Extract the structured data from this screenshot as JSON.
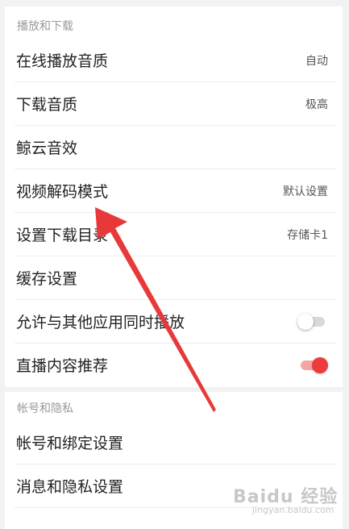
{
  "sections": {
    "playback": {
      "title": "播放和下载",
      "items": [
        {
          "label": "在线播放音质",
          "value": "自动"
        },
        {
          "label": "下载音质",
          "value": "极高"
        },
        {
          "label": "鲸云音效",
          "value": ""
        },
        {
          "label": "视频解码模式",
          "value": "默认设置"
        },
        {
          "label": "设置下载目录",
          "value": "存储卡1"
        },
        {
          "label": "缓存设置",
          "value": ""
        },
        {
          "label": "允许与其他应用同时播放",
          "toggle": false
        },
        {
          "label": "直播内容推荐",
          "toggle": true
        }
      ]
    },
    "account": {
      "title": "帐号和隐私",
      "items": [
        {
          "label": "帐号和绑定设置"
        },
        {
          "label": "消息和隐私设置"
        }
      ]
    }
  },
  "colors": {
    "accent": "#ec3b3b",
    "annotation_arrow": "#e8393a",
    "background": "#f2f2f2"
  },
  "watermark": {
    "main": "Baidu 经验",
    "sub": "jingyan.baidu.com"
  }
}
